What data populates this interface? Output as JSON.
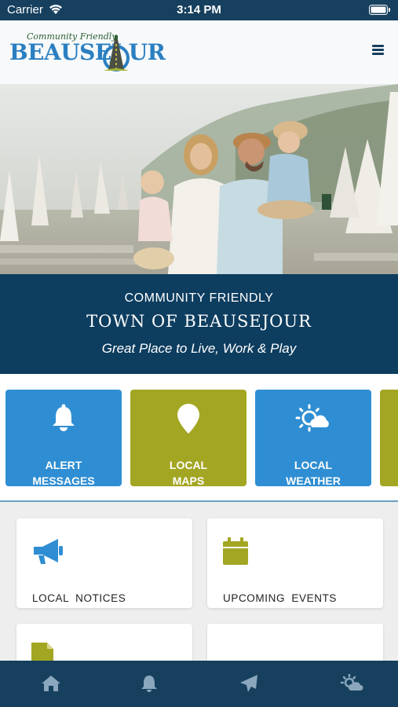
{
  "status_bar": {
    "carrier": "Carrier",
    "time": "3:14 PM"
  },
  "header": {
    "logo_tagline": "Community Friendly",
    "logo_name": "BEAUSEJ   UR",
    "menu_icon": "hamburger-menu-icon"
  },
  "banner": {
    "kicker": "COMMUNITY FRIENDLY",
    "title": "TOWN OF BEAUSEJOUR",
    "tagline": "Great Place to Live, Work & Play"
  },
  "quick_tiles": [
    {
      "line1": "ALERT",
      "line2": "MESSAGES",
      "icon": "bell-icon",
      "color": "#2f8ed3"
    },
    {
      "line1": "LOCAL",
      "line2": "MAPS",
      "icon": "map-pin-icon",
      "color": "#a3a623"
    },
    {
      "line1": "LOCAL",
      "line2": "WEATHER",
      "icon": "weather-icon",
      "color": "#2f8ed3"
    }
  ],
  "cards": [
    {
      "label": "LOCAL NOTICES",
      "icon": "megaphone-icon",
      "icon_color": "#2f8ed3"
    },
    {
      "label": "UPCOMING EVENTS",
      "icon": "calendar-icon",
      "icon_color": "#a3a623"
    }
  ],
  "tab_bar": {
    "items": [
      "home-icon",
      "bell-icon",
      "send-icon",
      "weather-icon"
    ],
    "icon_color": "#8ba7bd"
  },
  "colors": {
    "navy": "#0d3d5f",
    "status_bar": "#16405e",
    "accent_blue": "#2f8ed3",
    "accent_olive": "#a3a623"
  }
}
